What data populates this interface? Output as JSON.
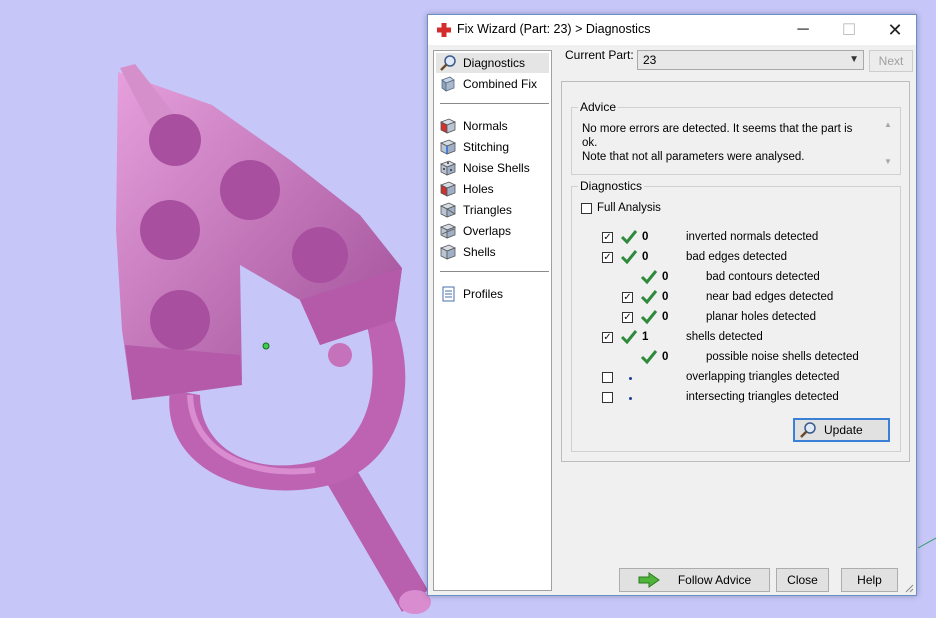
{
  "dialog": {
    "title": "Fix Wizard (Part: 23) > Diagnostics",
    "minimize_glyph": "─",
    "maximize_glyph": "☐",
    "close_glyph": "✕"
  },
  "nav": {
    "items": [
      {
        "label": "Diagnostics",
        "icon": "magnifier-icon"
      },
      {
        "label": "Combined Fix",
        "icon": "box-icon"
      },
      {
        "label": "Normals",
        "icon": "cube-red-face-icon"
      },
      {
        "label": "Stitching",
        "icon": "cube-stitch-icon"
      },
      {
        "label": "Noise Shells",
        "icon": "noise-shells-icon"
      },
      {
        "label": "Holes",
        "icon": "cube-hole-icon"
      },
      {
        "label": "Triangles",
        "icon": "triangles-icon"
      },
      {
        "label": "Overlaps",
        "icon": "overlaps-icon"
      },
      {
        "label": "Shells",
        "icon": "shells-icon"
      },
      {
        "label": "Profiles",
        "icon": "document-icon"
      }
    ]
  },
  "current_part": {
    "label": "Current Part:",
    "value": "23",
    "next_label": "Next"
  },
  "advice": {
    "title": "Advice",
    "line1": "No more errors are detected. It seems that the part is ok.",
    "line2": "Note that not all parameters were analysed."
  },
  "diagnostics": {
    "title": "Diagnostics",
    "full_analysis_label": "Full Analysis",
    "full_analysis_checked": false,
    "rows": [
      {
        "count": "0",
        "label": "inverted normals detected",
        "checked": true,
        "status": "ok"
      },
      {
        "count": "0",
        "label": "bad edges detected",
        "checked": true,
        "status": "ok"
      },
      {
        "count": "0",
        "label": "bad contours detected",
        "checked": null,
        "status": "ok"
      },
      {
        "count": "0",
        "label": "near bad edges detected",
        "checked": true,
        "status": "ok"
      },
      {
        "count": "0",
        "label": "planar holes detected",
        "checked": true,
        "status": "ok"
      },
      {
        "count": "1",
        "label": "shells detected",
        "checked": true,
        "status": "ok"
      },
      {
        "count": "0",
        "label": "possible noise shells detected",
        "checked": null,
        "status": "ok"
      },
      {
        "count": "",
        "label": "overlapping triangles detected",
        "checked": false,
        "status": "none"
      },
      {
        "count": "",
        "label": "intersecting triangles detected",
        "checked": false,
        "status": "none"
      }
    ],
    "update_label": "Update"
  },
  "buttons": {
    "follow_advice": "Follow Advice",
    "close": "Close",
    "help": "Help"
  },
  "colors": {
    "background": "#c6c6f9",
    "model": "#c266b8",
    "check": "#2f8a3c",
    "accent": "#3c7fd6"
  }
}
